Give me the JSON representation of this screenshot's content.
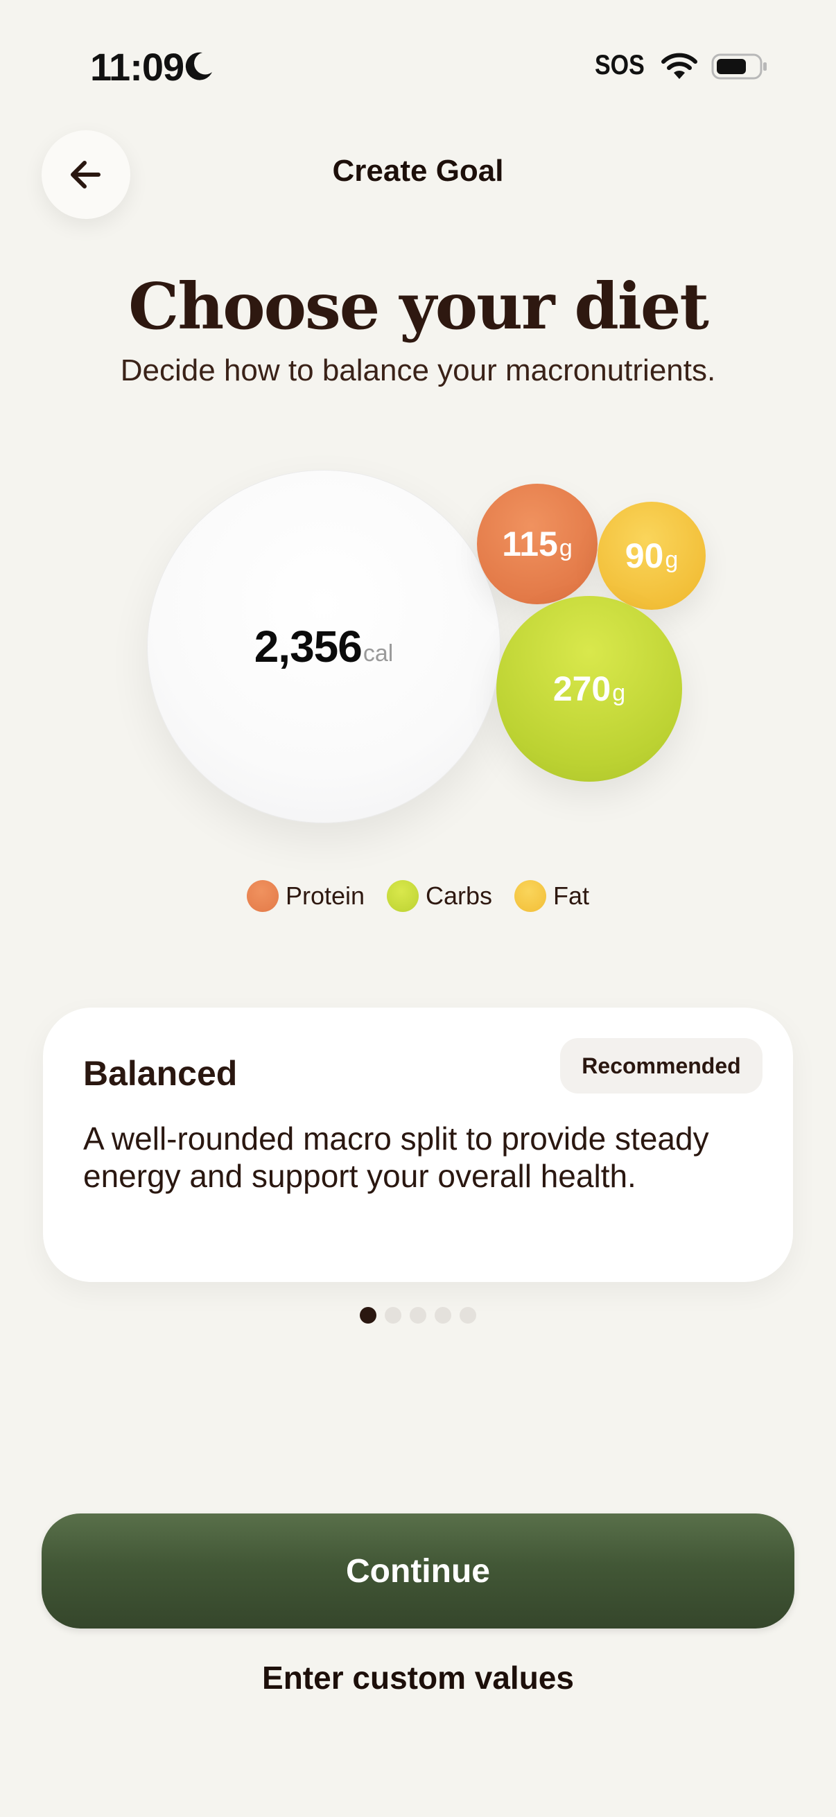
{
  "status_bar": {
    "time": "11:09",
    "sos": "SOS"
  },
  "header": {
    "title": "Create Goal"
  },
  "main": {
    "title": "Choose your diet",
    "subtitle": "Decide how to balance your macronutrients."
  },
  "macros": {
    "calories": {
      "value": "2,356",
      "unit": "cal"
    },
    "protein": {
      "value": "115",
      "unit": "g",
      "color": "#E37A48"
    },
    "fat": {
      "value": "90",
      "unit": "g",
      "color": "#F2BE37"
    },
    "carbs": {
      "value": "270",
      "unit": "g",
      "color": "#BCD232"
    }
  },
  "legend": {
    "protein": "Protein",
    "carbs": "Carbs",
    "fat": "Fat"
  },
  "card": {
    "title": "Balanced",
    "badge": "Recommended",
    "description": "A well-rounded macro split to provide steady energy and support your overall health."
  },
  "pager": {
    "total": 5,
    "active": 1
  },
  "actions": {
    "continue": "Continue",
    "custom": "Enter custom values"
  },
  "colors": {
    "background": "#F5F4EF",
    "primary_button": "#425736",
    "text": "#2A1710"
  }
}
